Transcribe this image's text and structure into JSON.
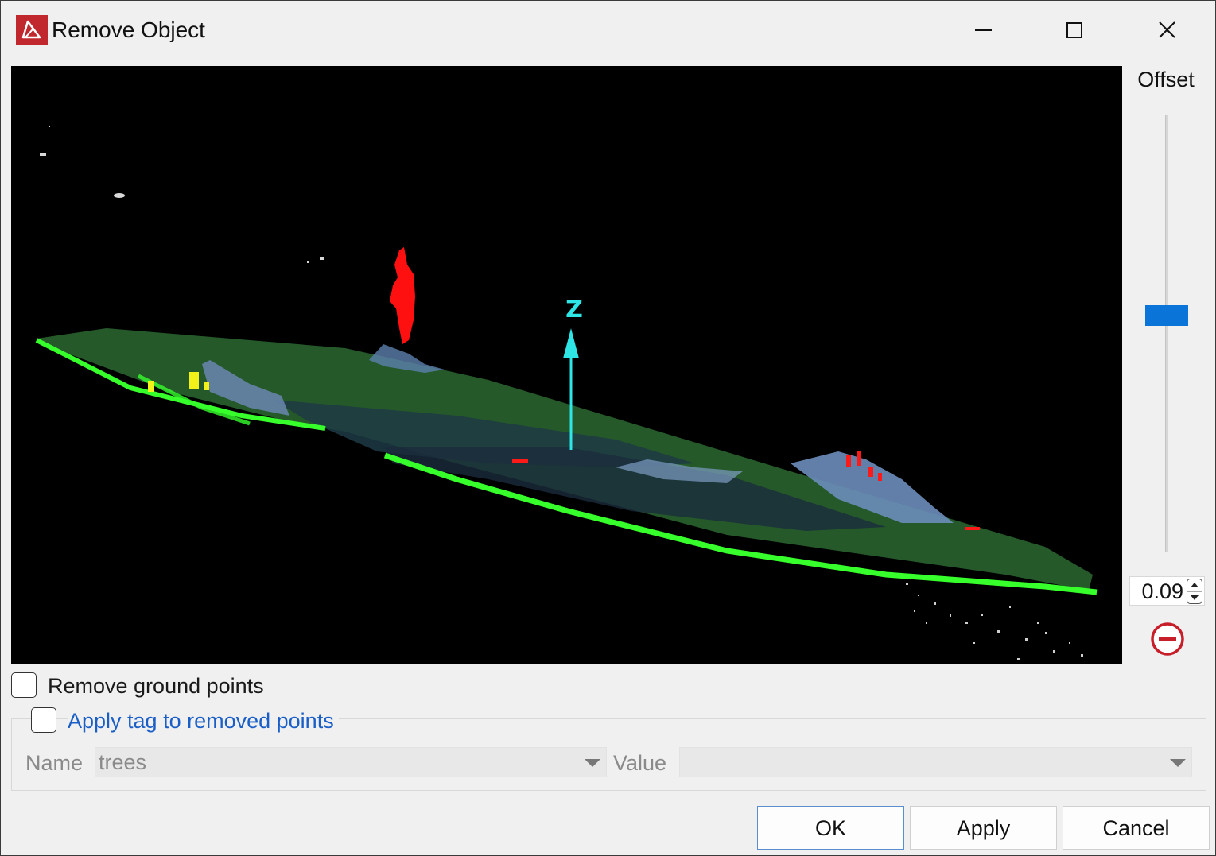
{
  "window": {
    "title": "Remove Object",
    "controls": {
      "minimize": "minimize-icon",
      "maximize": "maximize-icon",
      "close": "close-icon"
    }
  },
  "viewport": {
    "axis_label": "Z",
    "colors": {
      "background": "#000000",
      "ground": "#2b6a2f",
      "ground_edge": "#36ff2c",
      "selected_object": "#ff1010",
      "axis": "#2ee6e6",
      "terrain": "#5c7fae"
    }
  },
  "offset_panel": {
    "label": "Offset",
    "value": "0.09",
    "slider_level": 0.47,
    "accent": "#0a74d8",
    "remove_icon": "minus-circle-icon"
  },
  "options": {
    "remove_ground_points": {
      "label": "Remove ground points",
      "checked": false
    },
    "apply_tag": {
      "label": "Apply tag to removed points",
      "checked": false
    }
  },
  "tag_fields": {
    "name_label": "Name",
    "name_value": "trees",
    "value_label": "Value",
    "value_value": ""
  },
  "buttons": {
    "ok": "OK",
    "apply": "Apply",
    "cancel": "Cancel"
  }
}
